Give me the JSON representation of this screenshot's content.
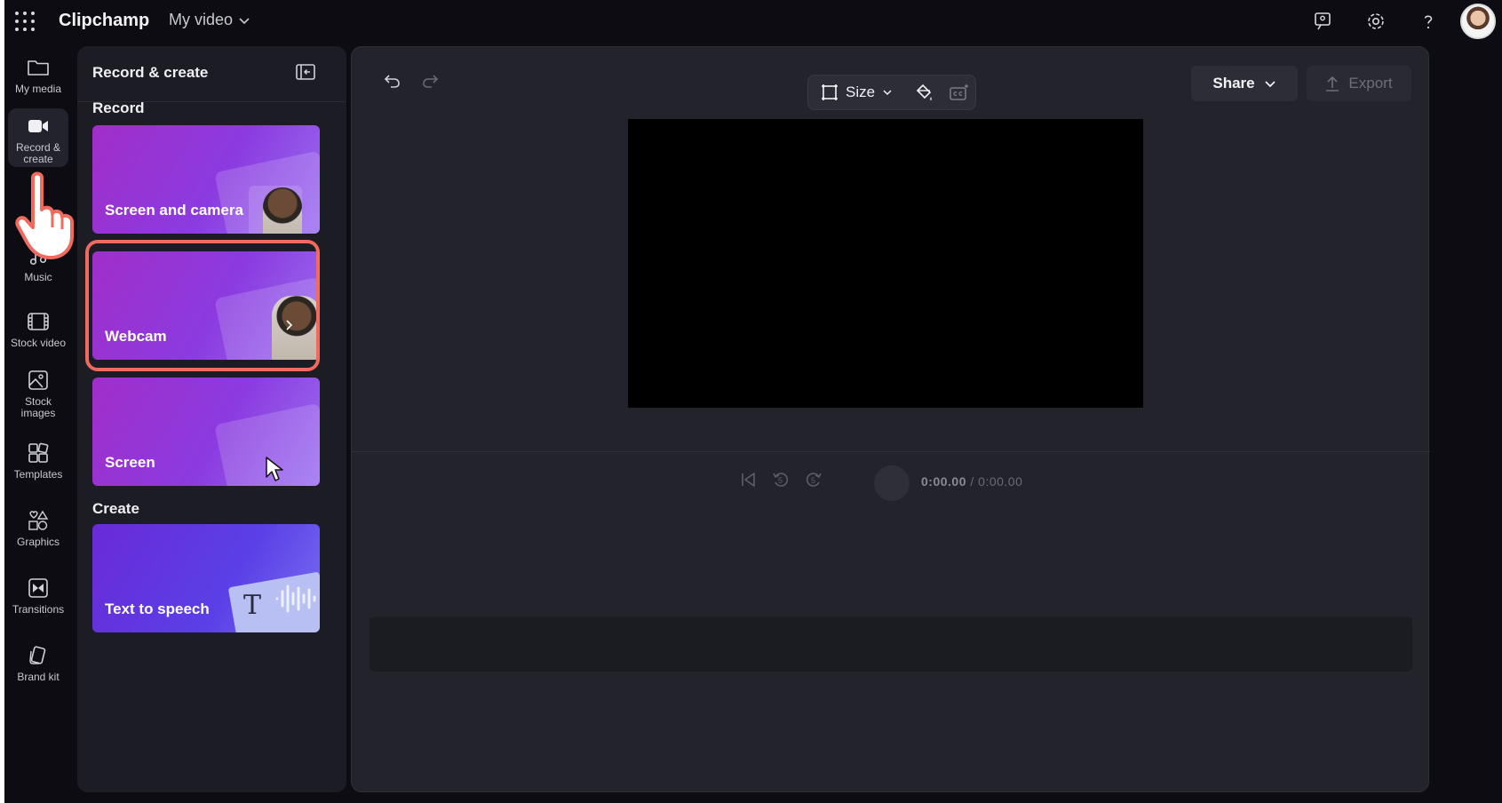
{
  "app": {
    "title": "Clipchamp",
    "project_name": "My video"
  },
  "topbar": {
    "icons": [
      "feedback-icon",
      "settings-icon",
      "help-icon"
    ]
  },
  "rail": {
    "items": [
      {
        "label": "My media",
        "icon": "folder-icon"
      },
      {
        "label": "Record & create",
        "icon": "video-camera-icon",
        "active": true
      },
      {
        "label": "Music",
        "icon": "music-note-icon"
      },
      {
        "label": "Stock video",
        "icon": "film-strip-icon"
      },
      {
        "label": "Stock images",
        "icon": "image-icon"
      },
      {
        "label": "Templates",
        "icon": "templates-icon"
      },
      {
        "label": "Graphics",
        "icon": "shapes-icon"
      },
      {
        "label": "Transitions",
        "icon": "transitions-icon"
      },
      {
        "label": "Brand kit",
        "icon": "brand-kit-icon"
      }
    ]
  },
  "panel": {
    "title": "Record & create",
    "record_section": "Record",
    "create_section": "Create",
    "cards": {
      "screen_and_camera": "Screen and camera",
      "webcam": "Webcam",
      "screen": "Screen",
      "text_to_speech": "Text to speech"
    }
  },
  "editor": {
    "size_label": "Size",
    "share_label": "Share",
    "export_label": "Export",
    "time_current": "0:00.00",
    "time_total": "/ 0:00.00",
    "skip_back_seconds": "5",
    "skip_forward_seconds": "5"
  },
  "colors": {
    "accent_ring": "#f06a5e",
    "card_purple": "#8b3be0",
    "background": "#0c0c12"
  }
}
